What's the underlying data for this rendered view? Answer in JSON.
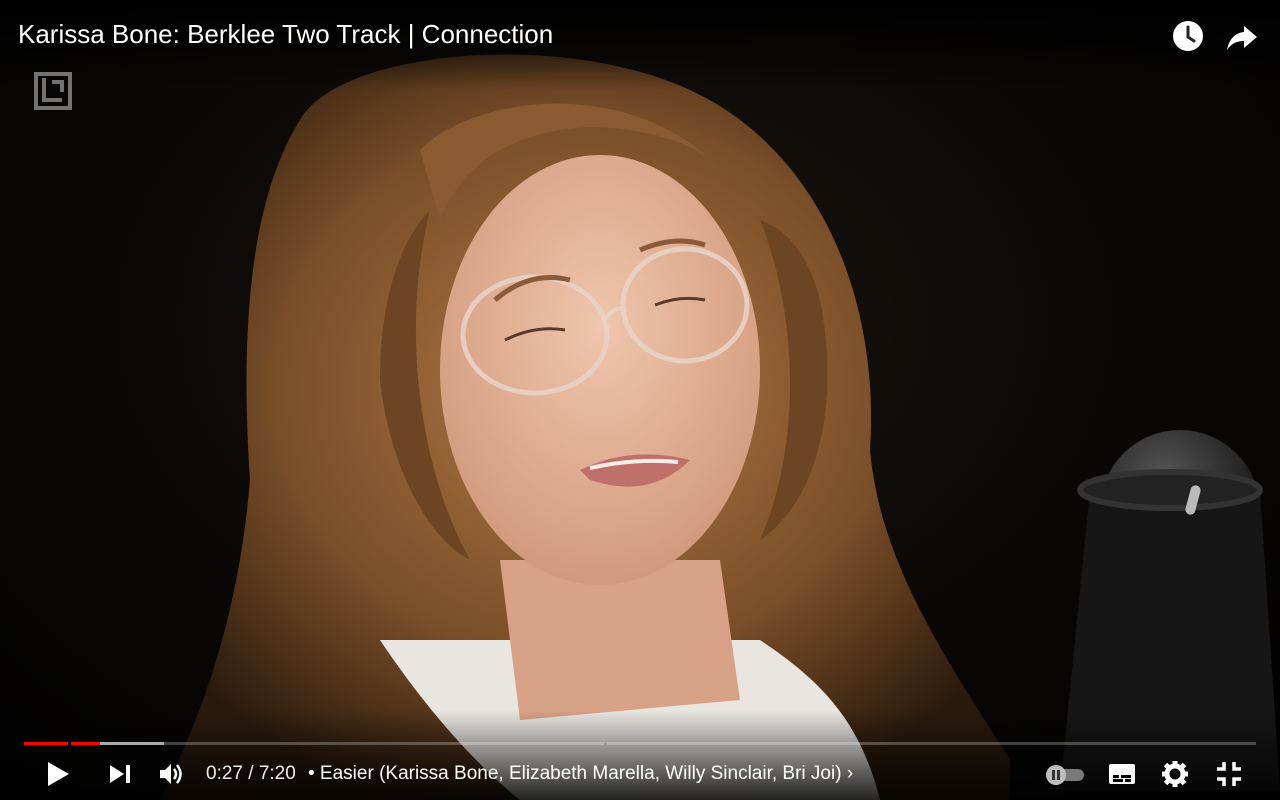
{
  "window": {
    "title": "Karissa Bone: Berklee Two Track | Connection"
  },
  "header": {
    "watch_later_icon": "clock-icon",
    "share_icon": "share-arrow-icon",
    "channel_logo_icon": "berklee-logo-icon"
  },
  "player": {
    "current_time": "0:27",
    "duration": "7:20",
    "time_display": "0:27 / 7:20",
    "chapter_title": "• Easier (Karissa Bone, Elizabeth Marella, Willy Sinclair, Bri Joi)",
    "chapter_chevron": "›",
    "played_fraction": 0.0614,
    "buffered_fraction": 0.114,
    "autoplay": "paused"
  },
  "controls": {
    "play_icon": "play-icon",
    "next_icon": "next-icon",
    "volume_icon": "volume-icon",
    "autoplay_icon": "autoplay-toggle-icon",
    "subtitles_icon": "subtitles-icon",
    "settings_icon": "gear-icon",
    "exit_fullscreen_icon": "exit-fullscreen-icon"
  },
  "colors": {
    "progress_played": "#ff0000",
    "progress_buffered": "#9e9e9e"
  }
}
